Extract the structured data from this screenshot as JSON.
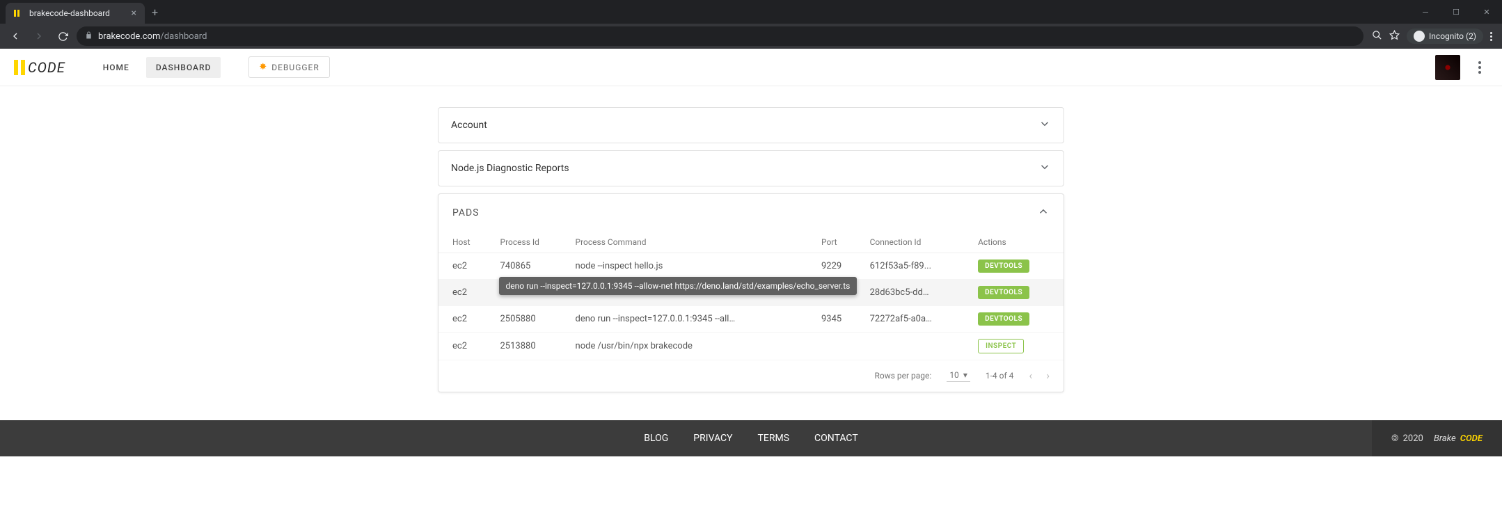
{
  "browser": {
    "tab_title": "brakecode-dashboard",
    "url_host": "brakecode.com",
    "url_path": "/dashboard",
    "incognito_label": "Incognito (2)"
  },
  "header": {
    "logo_text": "CODE",
    "nav": {
      "home": "HOME",
      "dashboard": "DASHBOARD"
    },
    "debugger_label": "DEBUGGER"
  },
  "accordions": {
    "account": "Account",
    "reports": "Node.js Diagnostic Reports"
  },
  "pads": {
    "title": "PADS",
    "columns": {
      "host": "Host",
      "pid": "Process Id",
      "cmd": "Process Command",
      "port": "Port",
      "conn": "Connection Id",
      "actions": "Actions"
    },
    "tooltip": "deno run --inspect=127.0.0.1:9345 --allow-net https://deno.land/std/examples/echo_server.ts",
    "rows": [
      {
        "host": "ec2",
        "pid": "740865",
        "cmd": "node --inspect hello.js",
        "port": "9229",
        "conn": "612f53a5-f89...",
        "action": "DEVTOOLS",
        "style": "dev"
      },
      {
        "host": "ec2",
        "pid": "",
        "cmd": "",
        "port": "",
        "conn": "28d63bc5-ddc...",
        "action": "DEVTOOLS",
        "style": "dev",
        "covered": true
      },
      {
        "host": "ec2",
        "pid": "2505880",
        "cmd": "deno run --inspect=127.0.0.1:9345 --allow-net ...",
        "port": "9345",
        "conn": "72272af5-a0a...",
        "action": "DEVTOOLS",
        "style": "dev"
      },
      {
        "host": "ec2",
        "pid": "2513880",
        "cmd": "node /usr/bin/npx brakecode",
        "port": "",
        "conn": "",
        "action": "INSPECT",
        "style": "inspect"
      }
    ],
    "pagination": {
      "rpp_label": "Rows per page:",
      "rpp_value": "10",
      "range": "1-4 of 4"
    }
  },
  "footer": {
    "links": {
      "blog": "BLOG",
      "privacy": "PRIVACY",
      "terms": "TERMS",
      "contact": "CONTACT"
    },
    "year": "2020",
    "brand1": "Brake",
    "brand2": "CODE"
  }
}
